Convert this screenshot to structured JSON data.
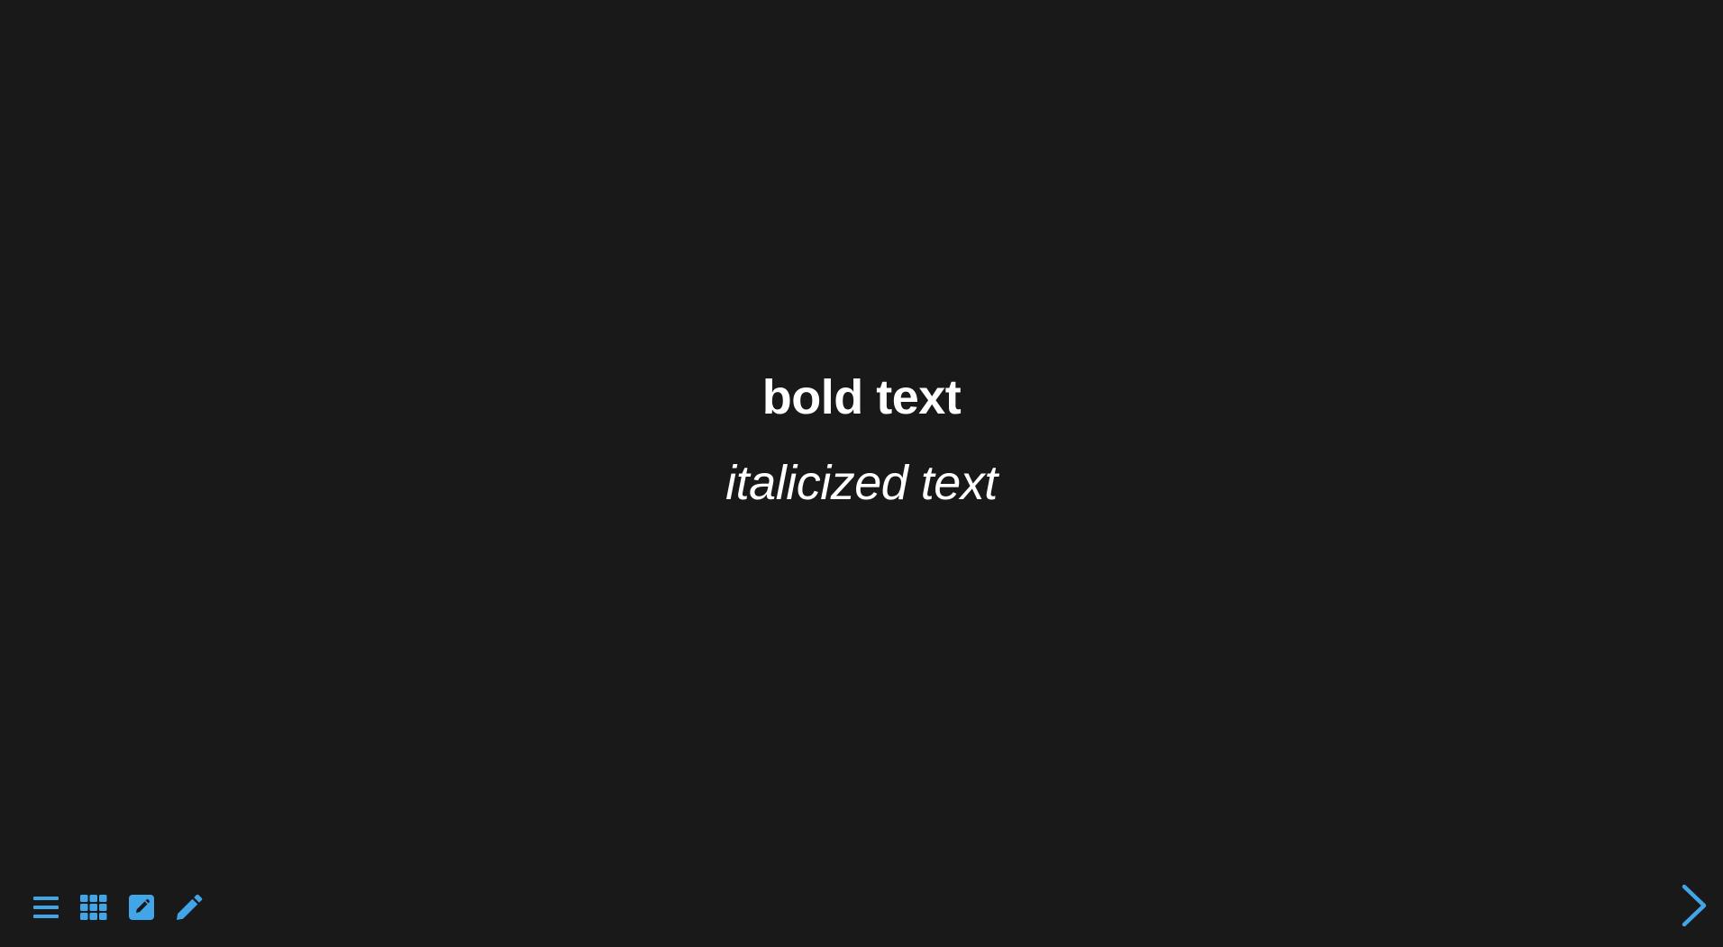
{
  "slide": {
    "bold_line": "bold text",
    "italic_line": "italicized text"
  },
  "toolbar": {
    "items": [
      {
        "icon": "menu-icon",
        "tooltip": ""
      },
      {
        "icon": "grid-icon",
        "tooltip": ""
      },
      {
        "icon": "edit-square-icon",
        "tooltip": ""
      },
      {
        "icon": "pencil-icon",
        "tooltip": ""
      }
    ]
  },
  "navigation": {
    "next_icon": "chevron-right-icon"
  },
  "colors": {
    "background": "#191919",
    "text": "#ffffff",
    "accent": "#42a5e8"
  }
}
